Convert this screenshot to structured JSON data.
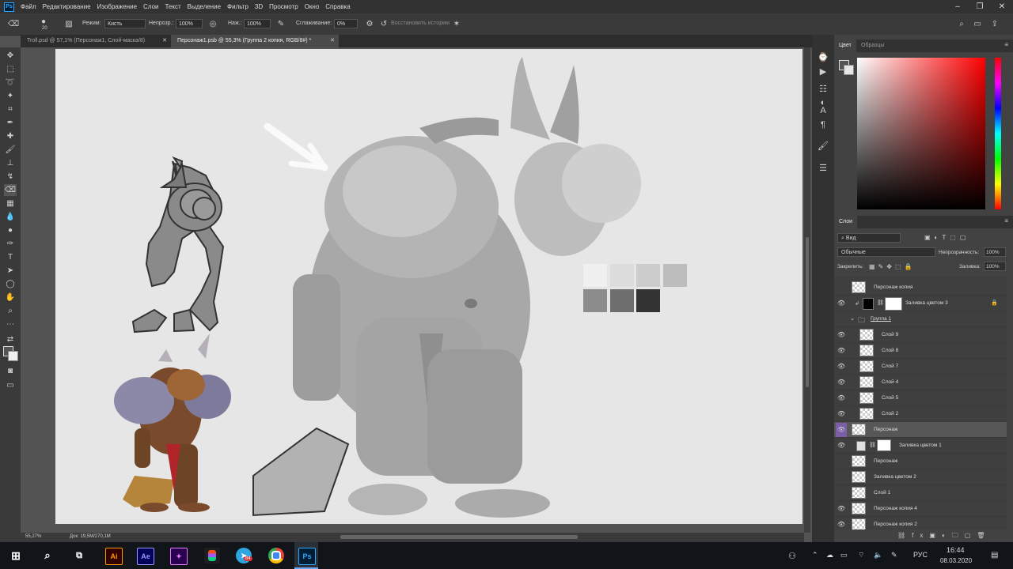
{
  "menu": {
    "app_logo": "Ps",
    "items": [
      "Файл",
      "Редактирование",
      "Изображение",
      "Слои",
      "Текст",
      "Выделение",
      "Фильтр",
      "3D",
      "Просмотр",
      "Окно",
      "Справка"
    ]
  },
  "options": {
    "brush_size": "20",
    "mode_label": "Режим:",
    "mode_value": "Кисть",
    "opacity_label": "Непрозр.:",
    "opacity_value": "100%",
    "flow_label": "Наж.:",
    "flow_value": "100%",
    "smoothing_label": "Сглаживание:",
    "smoothing_value": "0%",
    "history_label": "Восстановить историю"
  },
  "tabs": [
    {
      "label": "Troll.psd @ 57,1% (Персонаж1, Слой-маска/8)"
    },
    {
      "label": "Персонаж1.psb @ 55,3% (Группа 2 копия, RGB/8#) *"
    }
  ],
  "status": {
    "zoom": "55,27%",
    "doc": "Док: 19,5M/270,1M"
  },
  "color_panel": {
    "tab_color": "Цвет",
    "tab_swatches": "Образцы"
  },
  "swatches": [
    "#f0f0f0",
    "#dcdcdc",
    "#cccccc",
    "#bdbdbd",
    "#8c8c8c",
    "#6e6e6e",
    "#333333"
  ],
  "layers_panel": {
    "tab": "Слои",
    "filter_label": "Вид",
    "blend_mode": "Обычные",
    "opacity_label": "Непрозрачность:",
    "opacity_value": "100%",
    "lock_label": "Закрепить:",
    "fill_label": "Заливка:",
    "fill_value": "100%",
    "layers": [
      {
        "name": "Персонаж копия",
        "visible": false
      },
      {
        "name": "Заливка цветом 3",
        "visible": true
      },
      {
        "name": "Группа 1",
        "visible": false
      },
      {
        "name": "Слой 9",
        "visible": true
      },
      {
        "name": "Слой 8",
        "visible": true
      },
      {
        "name": "Слой 7",
        "visible": true
      },
      {
        "name": "Слой 4",
        "visible": true
      },
      {
        "name": "Слой 5",
        "visible": true
      },
      {
        "name": "Слой 2",
        "visible": true
      },
      {
        "name": "Персонаж",
        "visible": true
      },
      {
        "name": "Заливка цветом 1",
        "visible": true
      },
      {
        "name": "Персонаж",
        "visible": false
      },
      {
        "name": "Заливка цветом 2",
        "visible": false
      },
      {
        "name": "Слой 1",
        "visible": false
      },
      {
        "name": "Персонаж копия 4",
        "visible": true
      },
      {
        "name": "Персонаж копия 2",
        "visible": true
      }
    ]
  },
  "taskbar": {
    "apps": [
      "Ai",
      "Ae",
      "Pr",
      "Figma",
      "Telegram",
      "Chrome",
      "Ps"
    ],
    "telegram_badge": "84",
    "lang": "РУС",
    "time": "16:44",
    "date": "08.03.2020"
  }
}
